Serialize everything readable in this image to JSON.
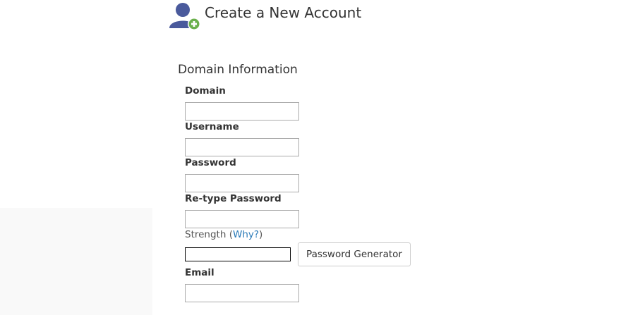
{
  "header": {
    "title": "Create a New Account",
    "icon": "add-user-icon",
    "icon_colors": {
      "user": "#4a5a9c",
      "badge": "#6ab04c"
    }
  },
  "domain_information": {
    "section_title": "Domain Information",
    "fields": {
      "domain": {
        "label": "Domain",
        "value": "",
        "placeholder": ""
      },
      "username": {
        "label": "Username",
        "value": "",
        "placeholder": ""
      },
      "password": {
        "label": "Password",
        "value": "",
        "placeholder": ""
      },
      "retype_password": {
        "label": "Re-type Password",
        "value": "",
        "placeholder": ""
      },
      "email": {
        "label": "Email",
        "value": "",
        "placeholder": ""
      }
    },
    "strength": {
      "label": "Strength",
      "open_paren": "(",
      "link_text": "Why?",
      "close_paren": ")",
      "level": 0
    },
    "password_generator_label": "Password Generator"
  },
  "colors": {
    "link": "#2a7ab8",
    "text": "#333333"
  }
}
